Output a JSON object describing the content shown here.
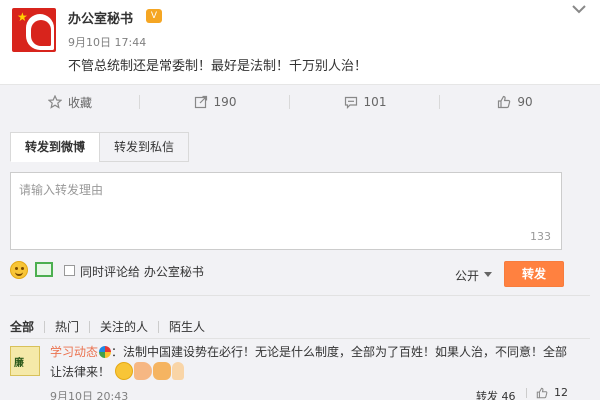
{
  "post": {
    "author": "办公室秘书",
    "time": "9月10日 17:44",
    "text": "不管总统制还是常委制！最好是法制！千万别人治！"
  },
  "actions": {
    "favorite": "收藏",
    "forward_count": "190",
    "comment_count": "101",
    "like_count": "90"
  },
  "forward_panel": {
    "tabs": [
      "转发到微博",
      "转发到私信"
    ],
    "placeholder": "请输入转发理由",
    "char_count": "133",
    "comment_also_label": "同时评论给 办公室秘书",
    "privacy": "公开",
    "forward_button": "转发"
  },
  "filters": [
    "全部",
    "热门",
    "关注的人",
    "陌生人"
  ],
  "repost": {
    "user": "学习动态",
    "text": "：法制中国建设势在必行！无论是什么制度，全部为了百姓！如果人治，不同意！全部让法律来！",
    "time": "9月10日 20:43",
    "forward": "转发 46",
    "like": "12"
  },
  "colors": {
    "accent": "#ff8140",
    "link": "#eb7350",
    "panel_bg": "#f2f2f5"
  }
}
